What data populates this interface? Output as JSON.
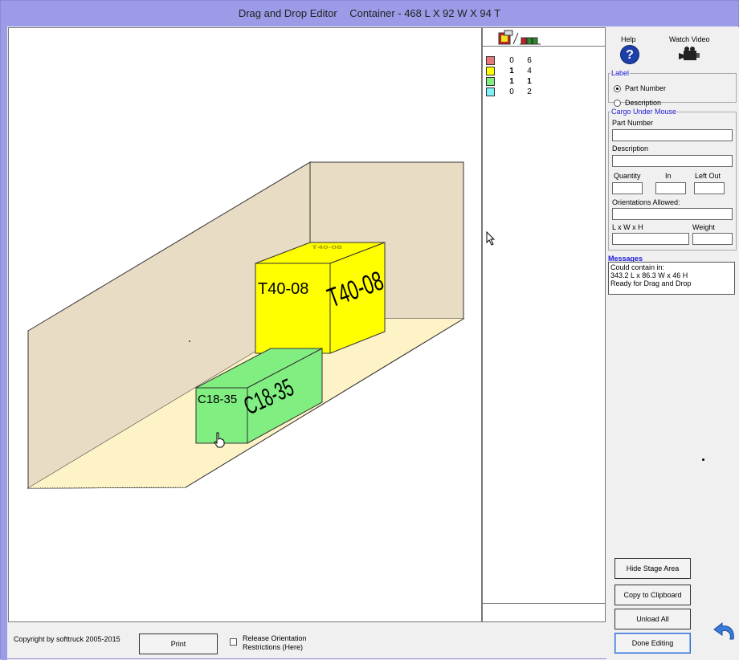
{
  "title": {
    "app": "Drag and Drop Editor",
    "container": "Container - 468 L X 92 W X 94 T"
  },
  "boxes": {
    "yellow_label": "T40-08",
    "green_label": "C18-35"
  },
  "legend": {
    "rows": [
      {
        "color": "#e87878",
        "placed": "0",
        "remaining": "6",
        "bold": false
      },
      {
        "color": "#ffff00",
        "placed": "1",
        "remaining": "4",
        "bold": true
      },
      {
        "color": "#80ee80",
        "placed": "1",
        "remaining": "1",
        "bold": true
      },
      {
        "color": "#80f0f8",
        "placed": "0",
        "remaining": "2",
        "bold": false
      }
    ]
  },
  "right": {
    "help": "Help",
    "watch_video": "Watch Video",
    "label_group": "Label",
    "label_part_number": "Part Number",
    "label_description": "Description",
    "cargo_group": "Cargo Under Mouse",
    "part_number": "Part Number",
    "description": "Description",
    "quantity": "Quantity",
    "in": "In",
    "left_out": "Left Out",
    "orientations": "Orientations Allowed:",
    "lwh": "L x W x H",
    "weight": "Weight",
    "messages_title": "Messages",
    "messages": [
      "Could contain in:",
      "343.2 L x 86.3 W x 46 H",
      "Ready for Drag and Drop"
    ],
    "hide_stage": "Hide Stage Area",
    "copy_clipboard": "Copy to Clipboard",
    "unload_all": "Unload All",
    "done_editing": "Done Editing"
  },
  "bottom": {
    "copyright": "Copyright by softtruck 2005-2015",
    "print": "Print",
    "release_line1": "Release Orientation",
    "release_line2": "Restrictions (Here)"
  },
  "colors": {
    "titlebar": "#9b9be8",
    "wall": "#e8dcc4",
    "floor": "#fdf3c6",
    "yellow_box": "#ffff00",
    "green_box": "#80ee80"
  }
}
